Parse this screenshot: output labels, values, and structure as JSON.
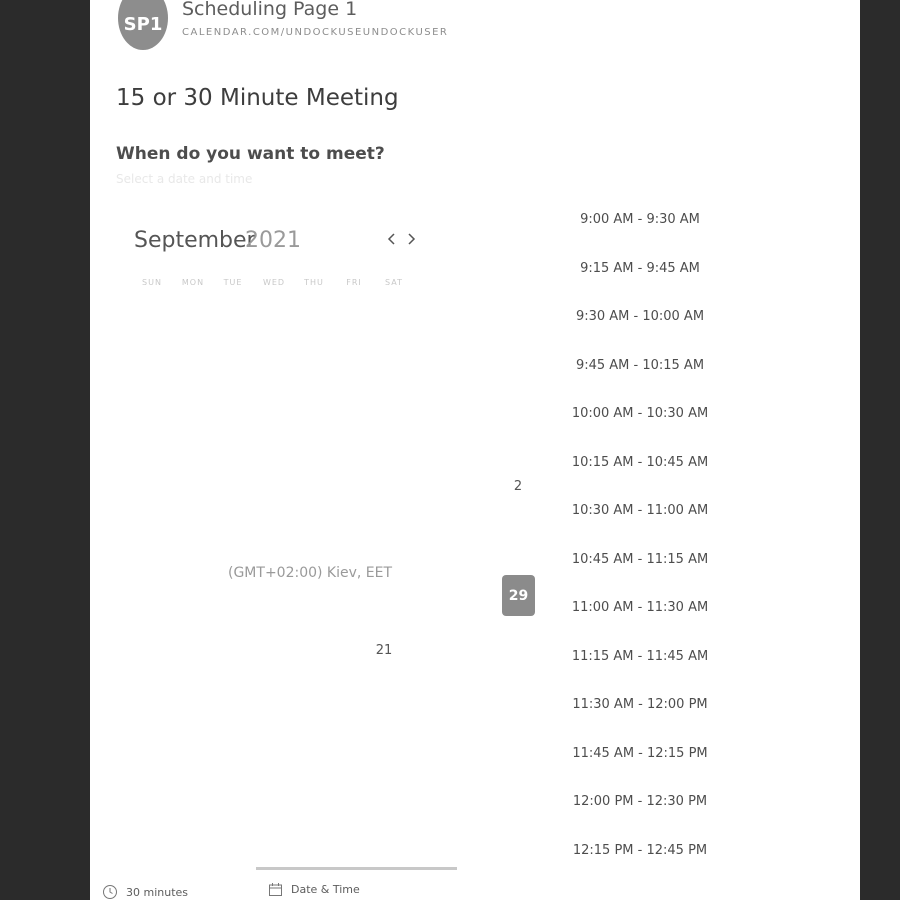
{
  "header": {
    "avatar_initials": "SP1",
    "page_name": "Scheduling Page 1",
    "url": "CALENDAR.COM/UNDOCKUSEUNDOCKUSER"
  },
  "meeting": {
    "title": "15 or 30 Minute Meeting",
    "question": "When do you want to meet?",
    "hint": "Select a date and time"
  },
  "calendar": {
    "month": "September",
    "year": "2021",
    "weekdays": [
      "SUN",
      "MON",
      "TUE",
      "WED",
      "THU",
      "FRI",
      "SAT"
    ],
    "visible_days": [
      "2",
      "21"
    ],
    "selected_day": "29",
    "timezone": "(GMT+02:00) Kiev, EET"
  },
  "time_slots": [
    "9:00 AM - 9:30 AM",
    "9:15 AM - 9:45 AM",
    "9:30 AM - 10:00 AM",
    "9:45 AM - 10:15 AM",
    "10:00 AM - 10:30 AM",
    "10:15 AM - 10:45 AM",
    "10:30 AM - 11:00 AM",
    "10:45 AM - 11:15 AM",
    "11:00 AM - 11:30 AM",
    "11:15 AM - 11:45 AM",
    "11:30 AM - 12:00 PM",
    "11:45 AM - 12:15 PM",
    "12:00 PM - 12:30 PM",
    "12:15 PM - 12:45 PM"
  ],
  "footer": {
    "duration": "30 minutes",
    "step_label": "Date & Time"
  },
  "icons": {
    "prev": "chevron-left-icon",
    "next": "chevron-right-icon",
    "duration": "clock-icon",
    "step": "calendar-icon"
  },
  "colors": {
    "background": "#2b2b2b",
    "page": "#ffffff",
    "avatar": "#8d8d8d",
    "selected_day": "#8b8b8b"
  }
}
